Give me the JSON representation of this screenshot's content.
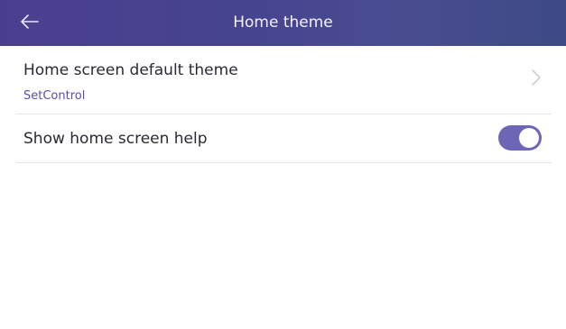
{
  "header": {
    "title": "Home theme",
    "back_icon": "arrow-left-icon",
    "background_color": "#46448f"
  },
  "settings": [
    {
      "title": "Home screen default theme",
      "value": "SetControl",
      "icon": "chevron-right-icon"
    },
    {
      "title": "Show home screen help",
      "control": "toggle",
      "enabled": true
    }
  ],
  "colors": {
    "accent": "#6d65b5",
    "value_text": "#5a4fa0",
    "divider": "#e6e6ea"
  }
}
